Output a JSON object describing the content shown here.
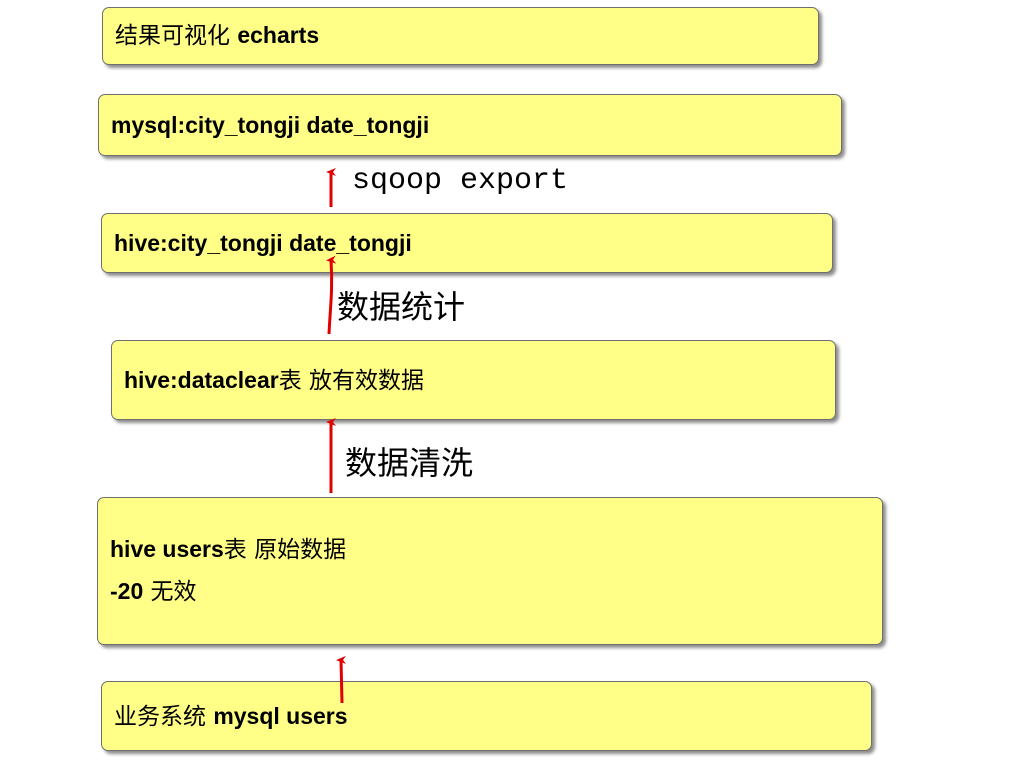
{
  "nodes": {
    "echarts": {
      "prefix": "结果可视化 ",
      "bold": "echarts"
    },
    "mysql_result": {
      "bold": "mysql:city_tongji date_tongji"
    },
    "hive_result": {
      "bold": "hive:city_tongji date_tongji"
    },
    "hive_dataclear": {
      "bold": "hive:dataclear",
      "suffix": "表 放有效数据"
    },
    "hive_users": {
      "line1_bold": "hive users",
      "line1_suffix": "表 原始数据",
      "line2_bold": "-20",
      "line2_suffix": " 无效"
    },
    "business": {
      "prefix": "业务系统 ",
      "bold": "mysql users"
    }
  },
  "edges": {
    "sqoop_export": "sqoop export",
    "stats": "数据统计",
    "cleaning": "数据清洗"
  },
  "colors": {
    "box_fill": "#ffff88",
    "arrow": "#e00000"
  }
}
